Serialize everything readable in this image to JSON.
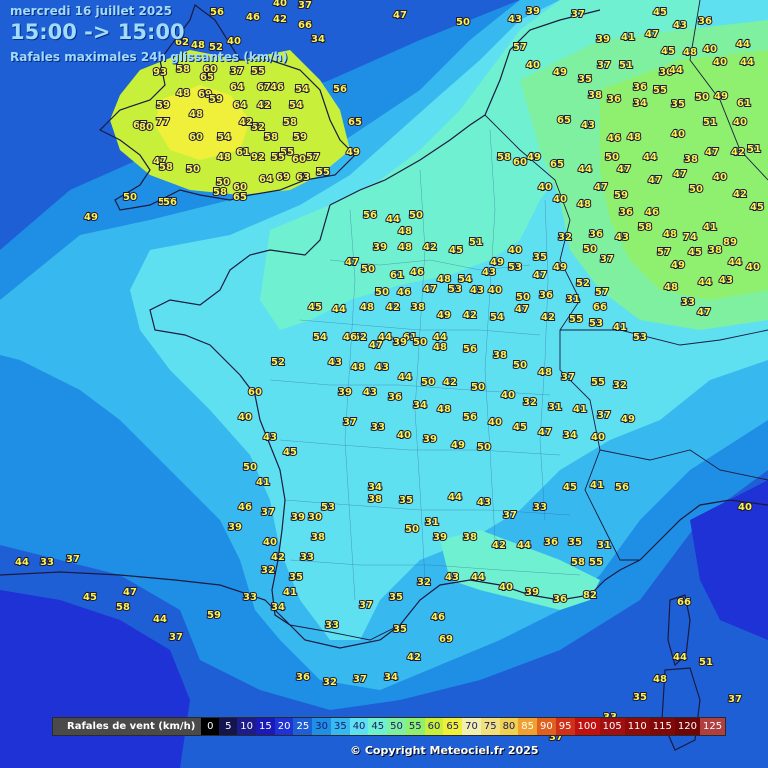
{
  "header": {
    "date": "mercredi 16 juillet 2025",
    "time_range": "15:00 -> 15:00",
    "subtitle": "Rafales maximales 24h glissantes (km/h)"
  },
  "legend": {
    "title": "Rafales de vent (km/h)",
    "scale": [
      {
        "v": "0",
        "bg": "#000000",
        "fg": "#ffffff"
      },
      {
        "v": "5",
        "bg": "#15154e",
        "fg": "#ffffff"
      },
      {
        "v": "10",
        "bg": "#1c1c8a",
        "fg": "#ffffff"
      },
      {
        "v": "15",
        "bg": "#1a1ab8",
        "fg": "#ffffff"
      },
      {
        "v": "20",
        "bg": "#1f32d6",
        "fg": "#ffffff"
      },
      {
        "v": "25",
        "bg": "#1f5fd6",
        "fg": "#ffffff"
      },
      {
        "v": "30",
        "bg": "#1f8fe6",
        "fg": "#1a1a6a"
      },
      {
        "v": "35",
        "bg": "#37b9f0",
        "fg": "#1a1a6a"
      },
      {
        "v": "40",
        "bg": "#5fe0f0",
        "fg": "#1a1a6a"
      },
      {
        "v": "45",
        "bg": "#6ff0d0",
        "fg": "#1a1a6a"
      },
      {
        "v": "50",
        "bg": "#7ff0a0",
        "fg": "#1a1a6a"
      },
      {
        "v": "55",
        "bg": "#8ff070",
        "fg": "#1a1a6a"
      },
      {
        "v": "60",
        "bg": "#c8f03a",
        "fg": "#1a1a6a"
      },
      {
        "v": "65",
        "bg": "#f0f03a",
        "fg": "#1a1a6a"
      },
      {
        "v": "70",
        "bg": "#f0f0b0",
        "fg": "#1a1a6a"
      },
      {
        "v": "75",
        "bg": "#f0e080",
        "fg": "#1a1a6a"
      },
      {
        "v": "80",
        "bg": "#f0d050",
        "fg": "#1a1a6a"
      },
      {
        "v": "85",
        "bg": "#f0a030",
        "fg": "#ffffff"
      },
      {
        "v": "90",
        "bg": "#e06020",
        "fg": "#ffffff"
      },
      {
        "v": "95",
        "bg": "#d03018",
        "fg": "#ffffff"
      },
      {
        "v": "100",
        "bg": "#c01010",
        "fg": "#ffffff"
      },
      {
        "v": "105",
        "bg": "#a01010",
        "fg": "#ffffff"
      },
      {
        "v": "110",
        "bg": "#900a0a",
        "fg": "#ffffff"
      },
      {
        "v": "115",
        "bg": "#800808",
        "fg": "#ffffff"
      },
      {
        "v": "120",
        "bg": "#700505",
        "fg": "#ffffff"
      },
      {
        "v": "125",
        "bg": "#b04040",
        "fg": "#ffffff"
      }
    ]
  },
  "copyright": "© Copyright Meteociel.fr 2025",
  "stations": {
    "uk": [
      "46",
      "40",
      "37",
      "42",
      "56",
      "66",
      "48",
      "34",
      "52",
      "62",
      "40",
      "58",
      "60",
      "37",
      "55",
      "65",
      "46",
      "54",
      "56",
      "93",
      "48",
      "69",
      "64",
      "67",
      "59",
      "64",
      "42",
      "54",
      "77",
      "48",
      "59",
      "52",
      "54",
      "58",
      "67",
      "80",
      "60",
      "47",
      "42",
      "61",
      "58",
      "59",
      "65",
      "48",
      "55",
      "57",
      "58",
      "50",
      "49",
      "92",
      "55",
      "60",
      "60",
      "50",
      "69",
      "63",
      "55",
      "57",
      "58",
      "65",
      "64",
      "50",
      "56",
      "49"
    ],
    "benelux_germany": [
      "47",
      "50",
      "43",
      "39",
      "37",
      "45",
      "43",
      "36",
      "39",
      "41",
      "47",
      "40",
      "44",
      "45",
      "48",
      "40",
      "44",
      "37",
      "51",
      "36",
      "44",
      "57",
      "40",
      "49",
      "35",
      "36",
      "55",
      "38",
      "36",
      "34",
      "35",
      "50",
      "49",
      "61",
      "65",
      "43",
      "46",
      "48",
      "40",
      "51",
      "40",
      "49",
      "65",
      "44",
      "50",
      "47",
      "44",
      "38",
      "47",
      "42",
      "51",
      "58",
      "60",
      "40",
      "40",
      "48",
      "47",
      "59",
      "47",
      "47",
      "50",
      "40",
      "42",
      "45",
      "36",
      "46",
      "48",
      "74",
      "41",
      "89",
      "36",
      "43",
      "58",
      "57",
      "49",
      "45",
      "38",
      "44",
      "40",
      "44",
      "43",
      "48",
      "33",
      "47"
    ],
    "north_france": [
      "56",
      "44",
      "50",
      "48",
      "39",
      "48",
      "42",
      "45",
      "51",
      "49",
      "40",
      "35",
      "32",
      "50",
      "37",
      "47",
      "50",
      "61",
      "46",
      "48",
      "54",
      "43",
      "53",
      "47",
      "49",
      "52",
      "57",
      "50",
      "46",
      "47",
      "53",
      "43",
      "40",
      "50",
      "36",
      "31",
      "66",
      "45",
      "44",
      "48",
      "42",
      "38",
      "49",
      "42",
      "54",
      "47",
      "42",
      "55",
      "53",
      "41",
      "53",
      "52",
      "44",
      "61",
      "44"
    ],
    "central_france": [
      "54",
      "46",
      "47",
      "39",
      "50",
      "48",
      "56",
      "38",
      "50",
      "48",
      "37",
      "55",
      "32",
      "43",
      "48",
      "43",
      "44",
      "50",
      "42",
      "50",
      "40",
      "32",
      "31",
      "41",
      "37",
      "49",
      "39",
      "43",
      "36",
      "34",
      "48",
      "56",
      "40",
      "45",
      "47",
      "34",
      "40",
      "37",
      "33",
      "40",
      "39",
      "49",
      "50"
    ],
    "south_france": [
      "34",
      "38",
      "53",
      "35",
      "31",
      "44",
      "43",
      "37",
      "33",
      "45",
      "41",
      "56",
      "50",
      "39",
      "38",
      "42",
      "44",
      "36",
      "35",
      "31",
      "37",
      "30",
      "32",
      "35",
      "33",
      "34",
      "33",
      "37",
      "35",
      "32",
      "43",
      "44",
      "40",
      "39",
      "36",
      "82",
      "69",
      "46",
      "35",
      "42",
      "34",
      "37",
      "32",
      "36",
      "58",
      "55",
      "66",
      "51",
      "37",
      "48",
      "44",
      "35",
      "33",
      "53",
      "37"
    ],
    "misc": [
      "52",
      "60",
      "40",
      "43",
      "45",
      "50",
      "41",
      "46",
      "39",
      "40",
      "42",
      "39",
      "38",
      "33",
      "41",
      "59",
      "44",
      "47",
      "45",
      "44",
      "33",
      "37",
      "58",
      "37",
      "40"
    ]
  }
}
